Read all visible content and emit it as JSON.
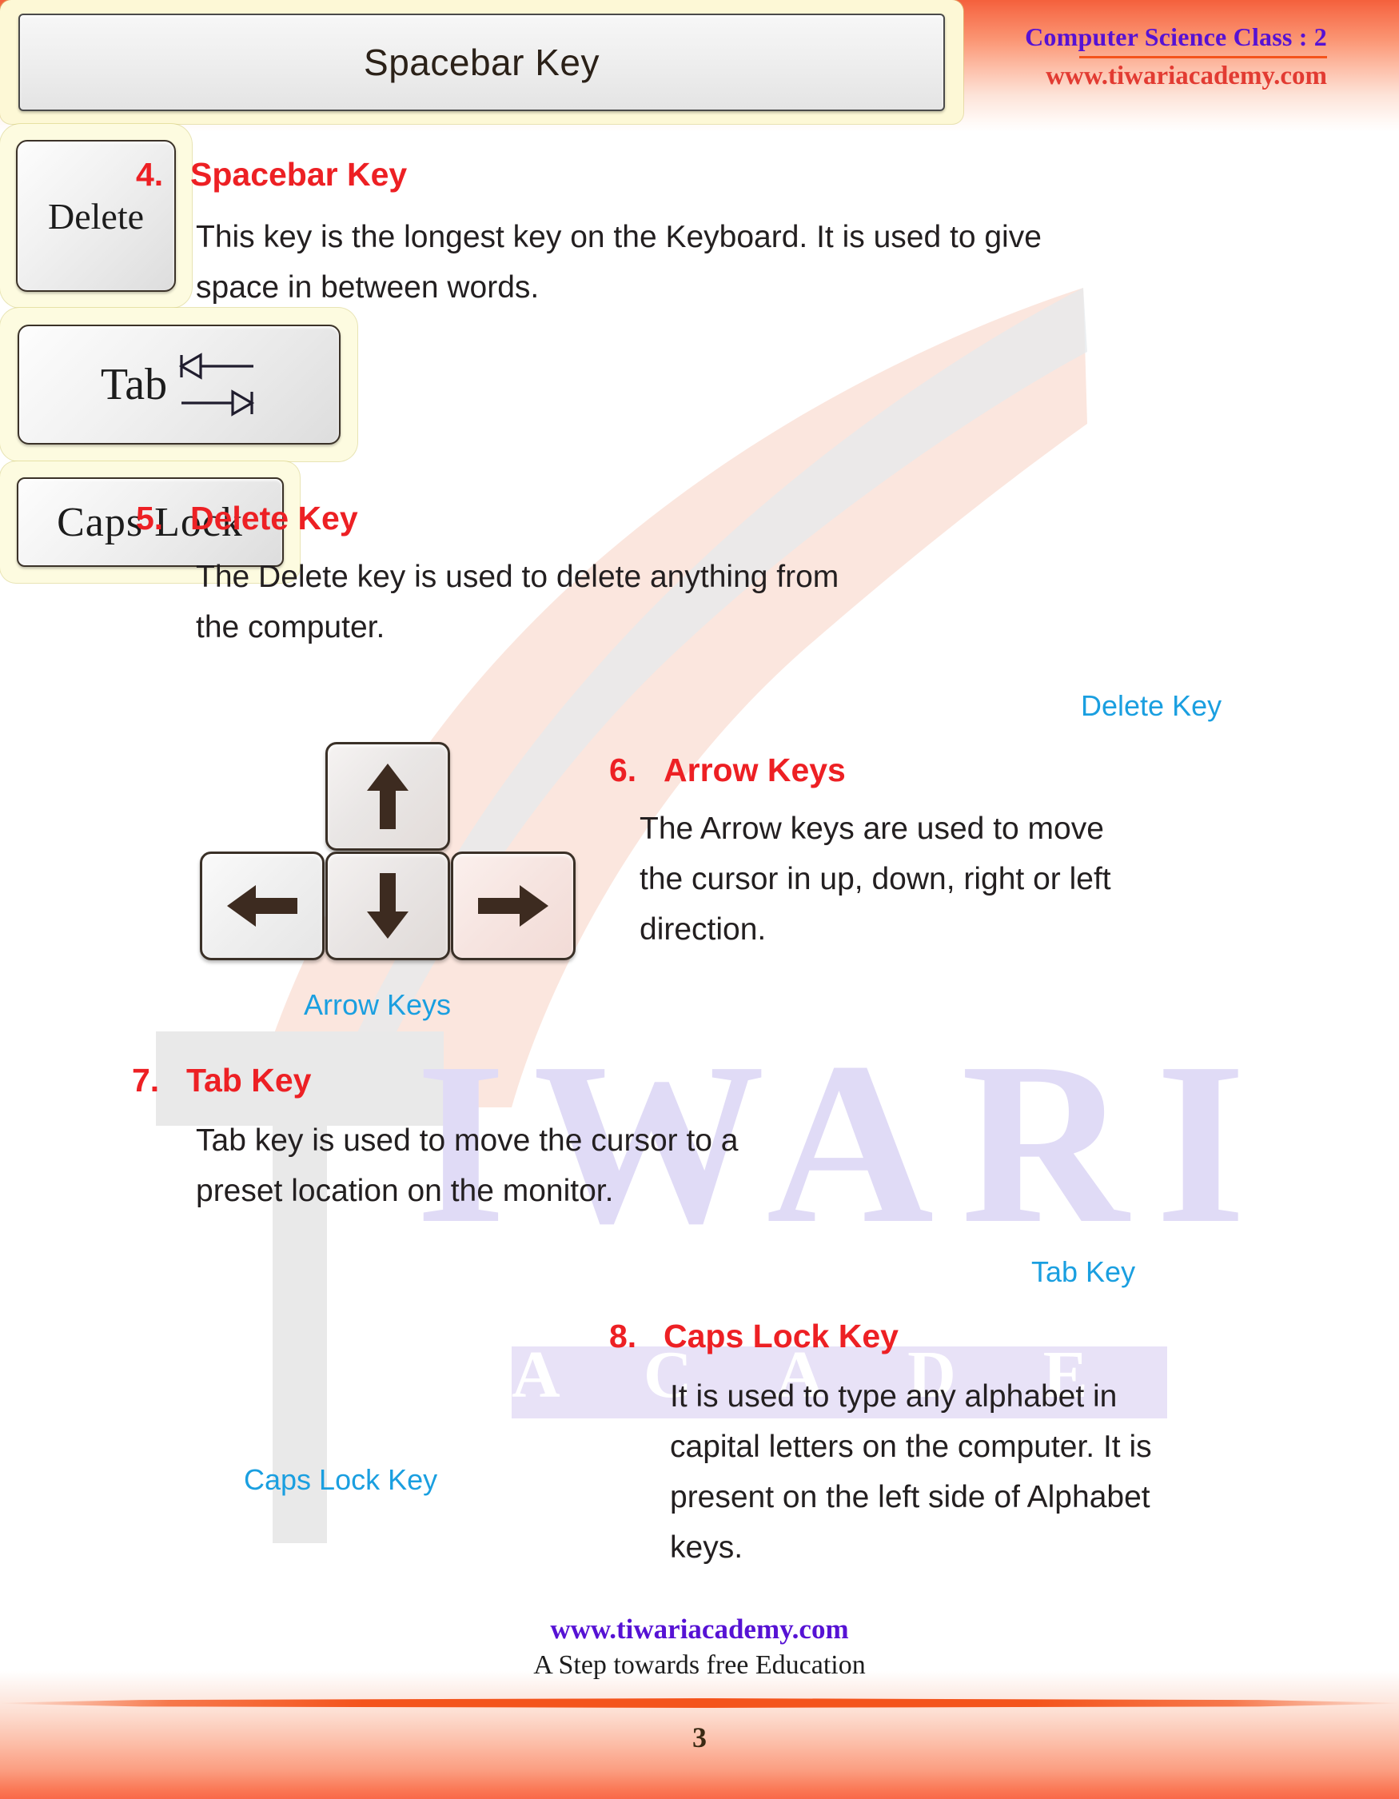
{
  "header": {
    "title": "Computer Science Class : 2",
    "url": "www.tiwariacademy.com"
  },
  "watermark": {
    "logo_letter": "T",
    "word": "IWARI",
    "word2": "A C A D E M Y"
  },
  "sections": [
    {
      "number": "4.",
      "title": "Spacebar Key",
      "body_lines": [
        "This key is the longest key on the Keyboard. It is used to give",
        "space in between words."
      ]
    },
    {
      "number": "5.",
      "title": "Delete Key",
      "body_lines": [
        "The Delete key is used to delete anything from",
        " the computer."
      ]
    },
    {
      "number": "6.",
      "title": "Arrow Keys",
      "body_lines": [
        "The Arrow  keys are used to move",
        "the cursor in up, down, right or left",
        "direction."
      ]
    },
    {
      "number": "7.",
      "title": "Tab Key",
      "body_lines": [
        "Tab key is used to move the cursor to a",
        " preset location on the monitor."
      ]
    },
    {
      "number": "8.",
      "title": "Caps Lock Key",
      "body_lines": [
        "It is used to type any alphabet in",
        "capital letters on the computer. It is",
        "present on the left side of Alphabet",
        "keys."
      ]
    }
  ],
  "figures": {
    "spacebar": {
      "key_label": "Spacebar Key"
    },
    "delete": {
      "key_label": "Delete",
      "caption": "Delete Key"
    },
    "arrows": {
      "caption": "Arrow Keys",
      "keys": [
        "up-arrow",
        "left-arrow",
        "down-arrow",
        "right-arrow"
      ]
    },
    "tab": {
      "key_label": "Tab",
      "caption": "Tab Key",
      "icon": "tab-arrows-icon"
    },
    "capslock": {
      "key_label": "Caps Lock",
      "caption": "Caps Lock Key"
    }
  },
  "footer": {
    "url": "www.tiwariacademy.com",
    "tagline": "A Step towards free Education",
    "page_number": "3"
  },
  "colors": {
    "heading_red": "#ed2024",
    "caption_blue": "#1a9fe0",
    "header_purple": "#5612d4",
    "header_red": "#e23b32",
    "banner_orange": "#f4603c",
    "key_border_yellow": "#fcf8d2"
  }
}
